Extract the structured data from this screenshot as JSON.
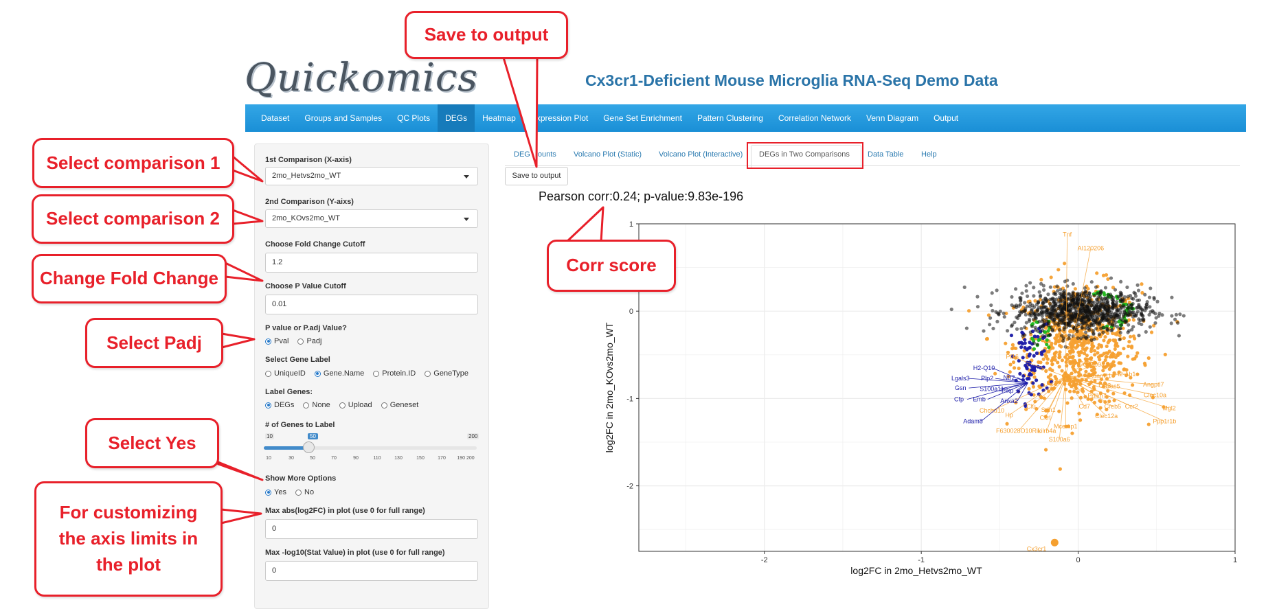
{
  "header": {
    "logo": "Quickomics",
    "title": "Cx3cr1-Deficient Mouse Microglia RNA-Seq Demo Data"
  },
  "navbar": {
    "items": [
      "Dataset",
      "Groups and Samples",
      "QC Plots",
      "DEGs",
      "Heatmap",
      "Expression Plot",
      "Gene Set Enrichment",
      "Pattern Clustering",
      "Correlation Network",
      "Venn Diagram",
      "Output"
    ],
    "active": "DEGs"
  },
  "sidebar": {
    "comp1_label": "1st Comparison (X-axis)",
    "comp1_value": "2mo_Hetvs2mo_WT",
    "comp2_label": "2nd Comparison (Y-aixs)",
    "comp2_value": "2mo_KOvs2mo_WT",
    "fc_label": "Choose Fold Change Cutoff",
    "fc_value": "1.2",
    "p_label": "Choose P Value Cutoff",
    "p_value": "0.01",
    "pval_type_label": "P value or P.adj Value?",
    "pval_type_options": [
      "Pval",
      "Padj"
    ],
    "pval_type_selected": "Pval",
    "gene_label_label": "Select Gene Label",
    "gene_label_options": [
      "UniqueID",
      "Gene.Name",
      "Protein.ID",
      "GeneType"
    ],
    "gene_label_selected": "Gene.Name",
    "label_genes_label": "Label Genes:",
    "label_genes_options": [
      "DEGs",
      "None",
      "Upload",
      "Geneset"
    ],
    "label_genes_selected": "DEGs",
    "n_genes_label": "# of Genes to Label",
    "n_genes_min": "10",
    "n_genes_max": "200",
    "n_genes_value": 50,
    "n_genes_ticks": [
      "10",
      "30",
      "50",
      "70",
      "90",
      "110",
      "130",
      "150",
      "170",
      "190 200"
    ],
    "more_options_label": "Show More Options",
    "more_options_options": [
      "Yes",
      "No"
    ],
    "more_options_selected": "Yes",
    "max_fc_label": "Max abs(log2FC) in plot (use 0 for full range)",
    "max_fc_value": "0",
    "max_stat_label": "Max -log10(Stat Value) in plot (use 0 for full range)",
    "max_stat_value": "0"
  },
  "tabs": {
    "items": [
      "DEG Counts",
      "Volcano Plot (Static)",
      "Volcano Plot (Interactive)",
      "DEGs in Two Comparisons",
      "Data Table",
      "Help"
    ],
    "active": "DEGs in Two Comparisons"
  },
  "save_button": "Save to output",
  "callouts": {
    "save": "Save to output",
    "comp1": "Select comparison 1",
    "comp2": "Select comparison 2",
    "fc": "Change Fold Change",
    "padj": "Select Padj",
    "yes": "Select Yes",
    "axis": "For customizing the axis limits in the plot",
    "corr": "Corr score"
  },
  "colors": {
    "accent_red": "#e8202a",
    "navbar": "#1a8fd6",
    "orange_points": "#f5a030",
    "blue_points": "#1a1aa8",
    "green_points": "#22b81e",
    "black_points": "#111111"
  },
  "chart_data": {
    "type": "scatter",
    "title": "Pearson corr:0.24; p-value:9.83e-196",
    "xlabel": "log2FC in 2mo_Hetvs2mo_WT",
    "ylabel": "log2FC in 2mo_KOvs2mo_WT",
    "xlim": [
      -2.8,
      1
    ],
    "ylim": [
      -2.75,
      1
    ],
    "xticks": [
      -2,
      -1,
      0,
      1
    ],
    "yticks": [
      -2,
      -1,
      0,
      1
    ],
    "grid": true,
    "legend": "none",
    "series": [
      {
        "color": "#111111",
        "center": [
          0.02,
          0.0
        ],
        "spread": [
          0.22,
          0.13
        ]
      },
      {
        "color": "#f5a030",
        "center": [
          0.0,
          -0.4
        ],
        "spread": [
          0.2,
          0.35
        ]
      },
      {
        "color": "#22b81e",
        "center": [
          0.2,
          0.1
        ],
        "spread": [
          0.15,
          0.15
        ]
      },
      {
        "color": "#1a1aa8",
        "center": [
          -0.35,
          -0.7
        ],
        "spread": [
          0.08,
          0.25
        ]
      }
    ],
    "highlight": {
      "label": "Cx3cr1",
      "x": -0.15,
      "y": -2.65
    },
    "orange_labels": [
      {
        "label": "Tnf",
        "x": -0.07,
        "y": 0.88
      },
      {
        "label": "AI120206",
        "x": 0.08,
        "y": 0.72
      },
      {
        "label": "Pf16",
        "x": -0.42,
        "y": -0.52
      },
      {
        "label": "Ms4a6b",
        "x": 0.05,
        "y": -0.59
      },
      {
        "label": "C3209a",
        "x": 0.1,
        "y": -0.61
      },
      {
        "label": "Adam11",
        "x": 0.14,
        "y": -0.74
      },
      {
        "label": "H2-Ab1",
        "x": 0.3,
        "y": -0.72
      },
      {
        "label": "Ccl3",
        "x": 0.17,
        "y": -0.85
      },
      {
        "label": "Gas5",
        "x": 0.22,
        "y": -0.86
      },
      {
        "label": "Angptl7",
        "x": 0.48,
        "y": -0.84
      },
      {
        "label": "Pdlim7",
        "x": 0.12,
        "y": -0.97
      },
      {
        "label": "Clec10a",
        "x": 0.49,
        "y": -0.96
      },
      {
        "label": "Cd7",
        "x": 0.04,
        "y": -1.09
      },
      {
        "label": "Creb5",
        "x": 0.22,
        "y": -1.09
      },
      {
        "label": "Ccr2",
        "x": 0.34,
        "y": -1.09
      },
      {
        "label": "Mgl2",
        "x": 0.58,
        "y": -1.11
      },
      {
        "label": "Clec12a",
        "x": 0.18,
        "y": -1.2
      },
      {
        "label": "Ppp1r1b",
        "x": 0.55,
        "y": -1.26
      },
      {
        "label": "Chchd10",
        "x": -0.55,
        "y": -1.14
      },
      {
        "label": "Hp",
        "x": -0.44,
        "y": -1.19
      },
      {
        "label": "Clu",
        "x": -0.3,
        "y": -1.09
      },
      {
        "label": "Ckrl",
        "x": -0.21,
        "y": -1.22
      },
      {
        "label": "Stfn1",
        "x": -0.19,
        "y": -1.13
      },
      {
        "label": "Lilrb4a",
        "x": -0.2,
        "y": -1.37
      },
      {
        "label": "Mcemp1",
        "x": -0.08,
        "y": -1.32
      },
      {
        "label": "S100a6",
        "x": -0.12,
        "y": -1.47
      },
      {
        "label": "F630028O10Rik",
        "x": -0.38,
        "y": -1.37
      }
    ],
    "blue_labels": [
      {
        "label": "H2-Q10",
        "x": -0.6,
        "y": -0.65
      },
      {
        "label": "Lgals3",
        "x": -0.75,
        "y": -0.77
      },
      {
        "label": "Plp2",
        "x": -0.58,
        "y": -0.77
      },
      {
        "label": "Ntr2",
        "x": -0.44,
        "y": -0.76
      },
      {
        "label": "Gsn",
        "x": -0.75,
        "y": -0.88
      },
      {
        "label": "S100a11",
        "x": -0.55,
        "y": -0.89
      },
      {
        "label": "Plkp",
        "x": -0.45,
        "y": -0.91
      },
      {
        "label": "Cfp",
        "x": -0.76,
        "y": -1.01
      },
      {
        "label": "Emb",
        "x": -0.63,
        "y": -1.01
      },
      {
        "label": "Anxa2",
        "x": -0.44,
        "y": -1.03
      },
      {
        "label": "Adam8",
        "x": -0.67,
        "y": -1.26
      }
    ]
  }
}
